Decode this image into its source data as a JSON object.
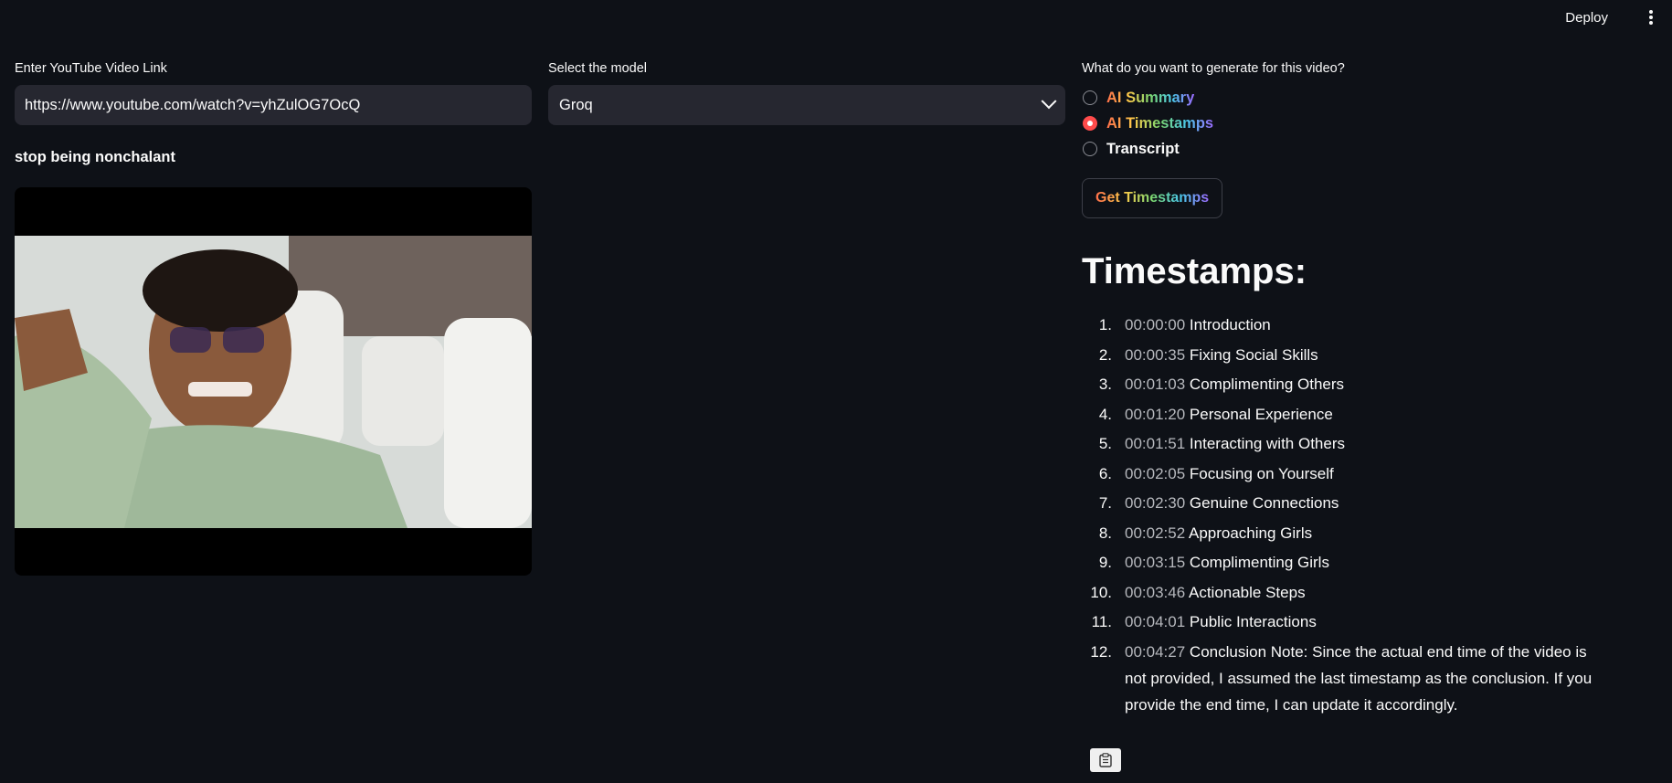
{
  "header": {
    "deploy_label": "Deploy"
  },
  "url_input": {
    "label": "Enter YouTube Video Link",
    "value": "https://www.youtube.com/watch?v=yhZulOG7OcQ"
  },
  "model_select": {
    "label": "Select the model",
    "value": "Groq"
  },
  "video": {
    "title": "stop being nonchalant"
  },
  "generate": {
    "question": "What do you want to generate for this video?",
    "options": [
      {
        "label": "AI Summary",
        "selected": false,
        "rainbow": true
      },
      {
        "label": "AI Timestamps",
        "selected": true,
        "rainbow": true
      },
      {
        "label": "Transcript",
        "selected": false,
        "rainbow": false
      }
    ],
    "button_label": "Get Timestamps"
  },
  "timestamps": {
    "heading": "Timestamps:",
    "items": [
      {
        "num": "1.",
        "time": "00:00:00",
        "text": "Introduction"
      },
      {
        "num": "2.",
        "time": "00:00:35",
        "text": "Fixing Social Skills"
      },
      {
        "num": "3.",
        "time": "00:01:03",
        "text": "Complimenting Others"
      },
      {
        "num": "4.",
        "time": "00:01:20",
        "text": "Personal Experience"
      },
      {
        "num": "5.",
        "time": "00:01:51",
        "text": "Interacting with Others"
      },
      {
        "num": "6.",
        "time": "00:02:05",
        "text": "Focusing on Yourself"
      },
      {
        "num": "7.",
        "time": "00:02:30",
        "text": "Genuine Connections"
      },
      {
        "num": "8.",
        "time": "00:02:52",
        "text": "Approaching Girls"
      },
      {
        "num": "9.",
        "time": "00:03:15",
        "text": "Complimenting Girls"
      },
      {
        "num": "10.",
        "time": "00:03:46",
        "text": "Actionable Steps"
      },
      {
        "num": "11.",
        "time": "00:04:01",
        "text": "Public Interactions"
      },
      {
        "num": "12.",
        "time": "00:04:27",
        "text": "Conclusion Note: Since the actual end time of the video is not provided, I assumed the last timestamp as the conclusion. If you provide the end time, I can update it accordingly."
      }
    ]
  }
}
